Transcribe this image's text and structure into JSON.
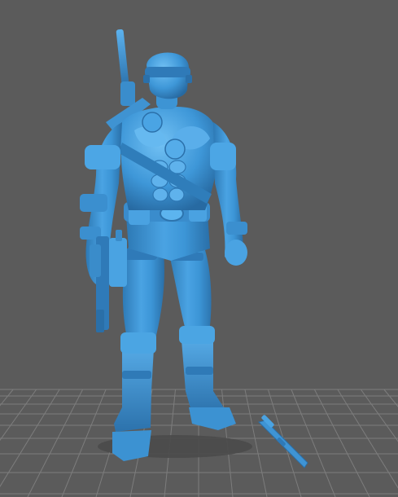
{
  "viewport": {
    "background_color": "#5b5b5b",
    "grid_color": "#7d7d7d",
    "model_color": "#3f94d4",
    "model_highlight_color": "#6cbcf2",
    "model_shadow_color": "#24628f",
    "shadow_color": "#484848"
  },
  "scene": {
    "model_name": "figure-model",
    "accessory_name": "blade-accessory"
  }
}
